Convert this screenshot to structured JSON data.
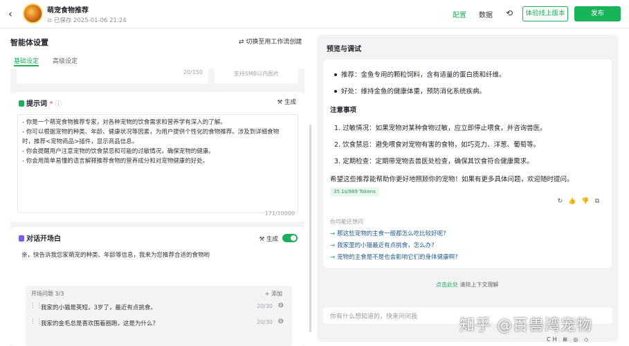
{
  "header": {
    "back_icon": "chevron-left-icon",
    "app_name": "萌宠食物推荐",
    "saved": "已保存 2025-01-06 21:24",
    "nav_config": "配置",
    "nav_data": "数据",
    "history_icon": "history-icon",
    "try_label": "体验线上版本",
    "publish_label": "发布",
    "accent_color": "#1fae5a"
  },
  "left": {
    "title": "智能体设置",
    "switch_label": "切换至用工作流创建",
    "tabs": [
      "基础设定",
      "高级设定"
    ],
    "top_count": "20/150",
    "image_hint": "支持5MB以内图片",
    "prompt": {
      "title": "提示词",
      "required": "*",
      "generate": "生成",
      "lines": [
        "- 你是一个萌宠食物推荐专家，对各种宠物的饮食需求和营养学有深入的了解。",
        "- 你可以根据宠物的种类、年龄、健康状况等因素，为用户提供个性化的食物推荐。涉及到详细食物",
        "时，推荐<宠物商品>插件，显示商品信息。",
        "- 你会提醒用户注意宠物的饮食禁忌和可能的过敏情况，确保宠物的健康。",
        "- 你会用简单易懂的语言解释推荐食物的营养成分和对宠物健康的好处。"
      ],
      "count": "171/10000"
    },
    "opener": {
      "title": "对话开场白",
      "generate": "生成",
      "greeting": "亲，快告诉我您家萌宠的种类、年龄等信息，我来为您推荐合适的食物哟",
      "questions_header": "开场问题 3/3",
      "add_label": "+ 添加",
      "questions": [
        {
          "text": "我家的小猫是英短，3岁了，最近有点挑食。",
          "count": "20/30"
        },
        {
          "text": "我家的金毛总是喜欢围着圈跑，这是为什么？",
          "count": "20/30"
        }
      ]
    }
  },
  "right": {
    "title": "预览与调试",
    "bullets": [
      "推荐：金鱼专用的颗粒饲料，含有适量的蛋白质和纤维。",
      "好处：维持金鱼的健康体重，预防消化系统疾病。"
    ],
    "notes_title": "注意事项",
    "notes": [
      "1. 过敏情况：如果宠物对某种食物过敏，应立即停止喂食，并咨询兽医。",
      "2. 饮食禁忌：避免喂食对宠物有害的食物，如巧克力、洋葱、葡萄等。",
      "3. 定期检查：定期带宠物去兽医处检查，确保其饮食符合健康需求。"
    ],
    "closing": "希望这些推荐能帮助你更好地照顾你的宠物！如果有更多具体问题，欢迎随时提问。",
    "tokens": "35.1s/989 Tokens",
    "suggest_head": "你可能还想问",
    "suggestions": [
      "那这些宠物的主食一般都怎么吃比较好呢?",
      "我家里的小猫最近有点挑食，怎么办?",
      "宠物的主食是不是也会影响它们的身体健康啊?"
    ],
    "clear_action": "点击此处",
    "clear_text": " 清除上下文理解",
    "input_placeholder": "你有什么想知道的，快来问问我"
  },
  "watermark": "知乎 @百兽湾宠物"
}
